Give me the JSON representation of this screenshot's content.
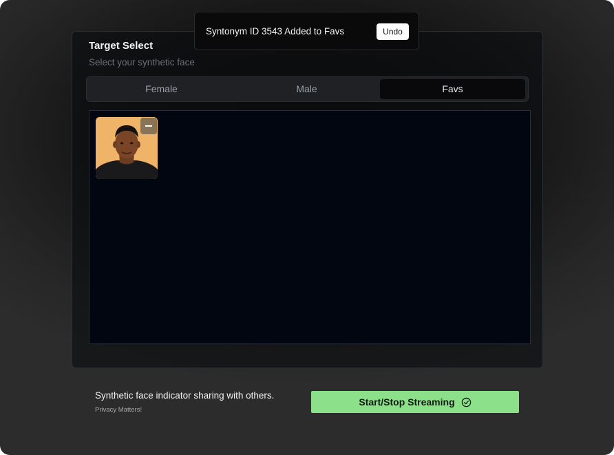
{
  "panel": {
    "title": "Target Select",
    "subtitle": "Select your synthetic face"
  },
  "tabs": [
    {
      "label": "Female",
      "selected": false
    },
    {
      "label": "Male",
      "selected": false
    },
    {
      "label": "Favs",
      "selected": true
    }
  ],
  "favorites": [
    {
      "icon": "face-thumbnail",
      "remove_icon": "minus-icon"
    }
  ],
  "toast": {
    "message": "Syntonym ID 3543 Added to Favs",
    "undo_label": "Undo"
  },
  "footer": {
    "indicator_text": "Synthetic face indicator sharing with others.",
    "privacy_text": "Privacy Matters!",
    "stream_button_label": "Start/Stop Streaming",
    "stream_button_icon": "check-circle-icon"
  },
  "colors": {
    "accent_green": "#8ce08a",
    "grid_background": "#020611",
    "thumbnail_background": "#efb468"
  }
}
